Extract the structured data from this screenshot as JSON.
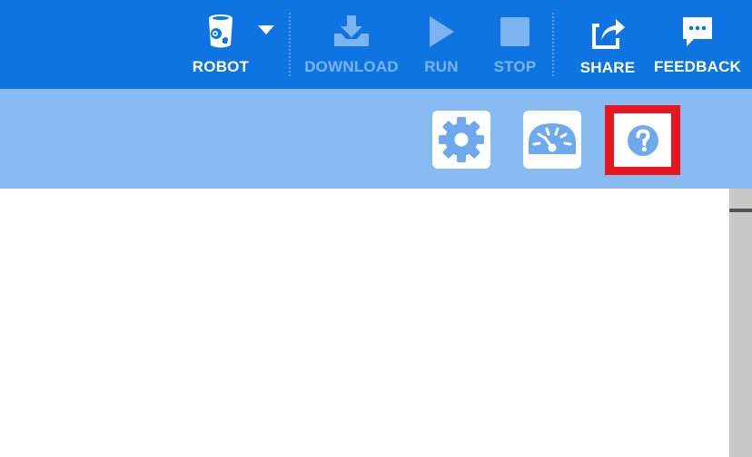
{
  "toolbar": {
    "robot_label": "ROBOT",
    "download_label": "DOWNLOAD",
    "run_label": "RUN",
    "stop_label": "STOP",
    "share_label": "SHARE",
    "feedback_label": "FEEDBACK"
  },
  "colors": {
    "toolbar_bg": "#0d74e2",
    "subbar_bg": "#87bbf1",
    "highlight": "#e8141e",
    "disabled_text": "#7db3ee"
  },
  "icons": {
    "robot": "robot-icon",
    "dropdown": "caret-down-icon",
    "download": "download-icon",
    "run": "play-icon",
    "stop": "stop-icon",
    "share": "share-icon",
    "feedback": "chat-bubble-icon",
    "settings": "gear-icon",
    "dashboard": "speedometer-icon",
    "help": "question-mark-icon"
  }
}
